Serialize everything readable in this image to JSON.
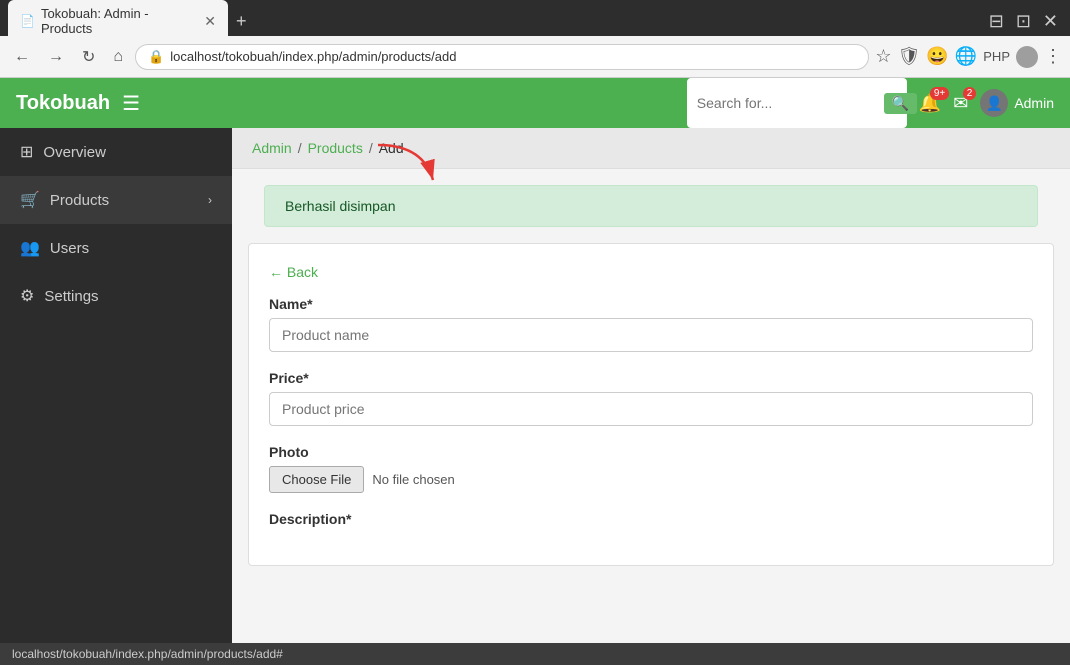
{
  "browser": {
    "tab_title": "Tokobuah: Admin - Products",
    "url": "localhost/tokobuah/index.php/admin/products/add",
    "new_tab_label": "+",
    "nav": {
      "back_label": "←",
      "forward_label": "→",
      "reload_label": "↻",
      "home_label": "⌂"
    }
  },
  "topnav": {
    "brand": "Tokobuah",
    "hamburger_label": "☰",
    "search_placeholder": "Search for...",
    "search_button_label": "🔍",
    "bell_badge": "9+",
    "mail_badge": "2",
    "user_label": "Admin"
  },
  "sidebar": {
    "items": [
      {
        "id": "overview",
        "label": "Overview",
        "icon": "⊞",
        "has_chevron": false
      },
      {
        "id": "products",
        "label": "Products",
        "icon": "🛒",
        "has_chevron": true
      },
      {
        "id": "users",
        "label": "Users",
        "icon": "👥",
        "has_chevron": false
      },
      {
        "id": "settings",
        "label": "Settings",
        "icon": "⚙",
        "has_chevron": false
      }
    ]
  },
  "breadcrumb": {
    "admin_label": "Admin",
    "products_label": "Products",
    "add_label": "Add",
    "sep": "/"
  },
  "alert": {
    "message": "Berhasil disimpan"
  },
  "form": {
    "back_label": "← Back",
    "name_label": "Name*",
    "name_placeholder": "Product name",
    "price_label": "Price*",
    "price_placeholder": "Product price",
    "photo_label": "Photo",
    "choose_file_label": "Choose File",
    "no_file_label": "No file chosen",
    "description_label": "Description*"
  },
  "status_bar": {
    "url": "localhost/tokobuah/index.php/admin/products/add#"
  }
}
